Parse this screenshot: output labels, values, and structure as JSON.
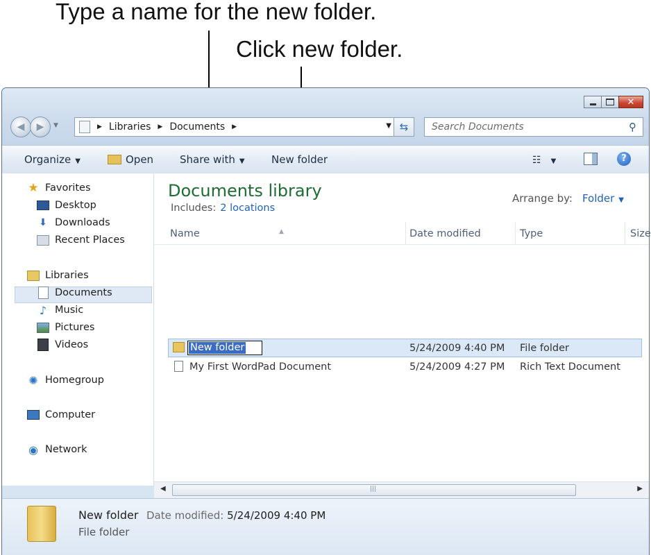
{
  "callouts": {
    "type_name": "Type a name for the new folder.",
    "click_new_folder": "Click new folder."
  },
  "window": {
    "buttons": [
      "minimize",
      "maximize",
      "close"
    ]
  },
  "address_bar": {
    "segments": [
      "Libraries",
      "Documents"
    ],
    "search_placeholder": "Search Documents"
  },
  "toolbar": {
    "organize": "Organize",
    "open": "Open",
    "share_with": "Share with",
    "new_folder": "New folder"
  },
  "nav": {
    "favorites": "Favorites",
    "desktop": "Desktop",
    "downloads": "Downloads",
    "recent_places": "Recent Places",
    "libraries": "Libraries",
    "documents": "Documents",
    "music": "Music",
    "pictures": "Pictures",
    "videos": "Videos",
    "homegroup": "Homegroup",
    "computer": "Computer",
    "network": "Network"
  },
  "library": {
    "title": "Documents library",
    "includes_label": "Includes:",
    "includes_link": "2 locations",
    "arrange_label": "Arrange by:",
    "arrange_value": "Folder"
  },
  "columns": {
    "name": "Name",
    "date_modified": "Date modified",
    "type": "Type",
    "size": "Size"
  },
  "files": [
    {
      "name": "New folder",
      "date": "5/24/2009 4:40 PM",
      "type": "File folder"
    },
    {
      "name": "My First WordPad Document",
      "date": "5/24/2009 4:27 PM",
      "type": "Rich Text Document"
    }
  ],
  "details": {
    "name": "New folder",
    "date_label": "Date modified:",
    "date_value": "5/24/2009 4:40 PM",
    "type": "File folder"
  },
  "colors": {
    "accent": "#1f62b8",
    "library_title": "#1e6c33",
    "selection": "#3a6cc4"
  }
}
